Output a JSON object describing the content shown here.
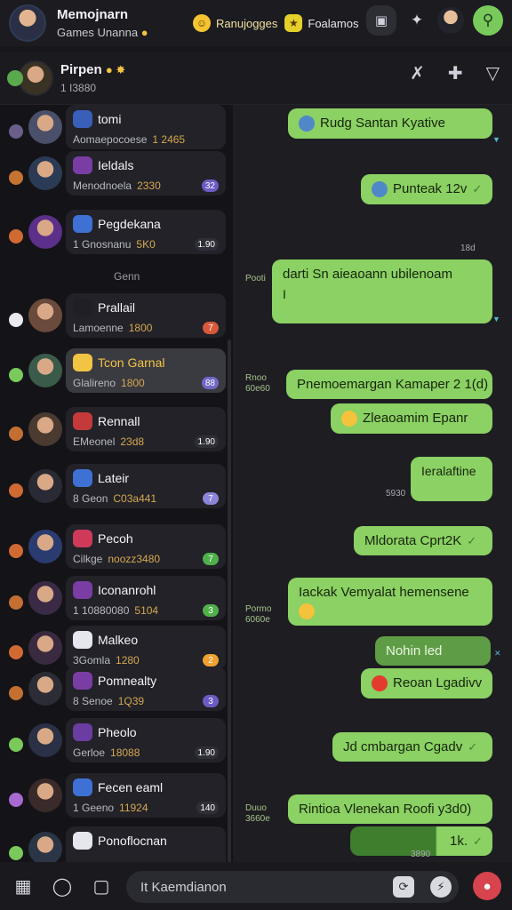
{
  "top": {
    "title": "Memojnarn",
    "subtitle": "Games Unanna",
    "chip1": "Ranujogges",
    "chip2": "Foalamos"
  },
  "chat_header": {
    "name": "Pirpen",
    "sub": "1 I3880"
  },
  "section_label": "Genn",
  "chats": [
    {
      "name": "tomi",
      "preview": "Aomaepocoese",
      "meta": "1 2465",
      "badge": "",
      "status": "#6a5f8a",
      "tile": "#3a5fb8",
      "avatar": "#4a4f6a",
      "badge_color": "#444"
    },
    {
      "name": "Ieldals",
      "preview": "Menodnoela",
      "meta": "2330",
      "badge": "32",
      "status": "#c47431",
      "tile": "#7a3da3",
      "avatar": "#2b3b55",
      "badge_color": "#6b5bc4"
    },
    {
      "name": "Pegdekana",
      "preview": "1 Gnosnanu",
      "meta": "5K0",
      "badge": "1.90",
      "status": "#d06a32",
      "tile": "#3f71d4",
      "avatar": "#5b2f8a",
      "badge_color": "#2f2f38"
    },
    {
      "name": "Prallail",
      "preview": "Lamoenne",
      "meta": "1800",
      "badge": "7",
      "status": "#e9e9ef",
      "tile": "#1f1f25",
      "avatar": "#6a4a3a",
      "badge_color": "#d8583a"
    },
    {
      "name": "Tcon Garnal",
      "preview": "Glalireno",
      "meta": "1800",
      "badge": "88",
      "status": "#79c95b",
      "tile": "#f2c443",
      "avatar": "#3a5a4a",
      "badge_color": "#7067c8",
      "active": true
    },
    {
      "name": "Rennall",
      "preview": "EMeonel",
      "meta": "23d8",
      "badge": "1.90",
      "status": "#c46f32",
      "tile": "#c43a3a",
      "avatar": "#4a3a30",
      "badge_color": "#2f2f38"
    },
    {
      "name": "Lateir",
      "preview": "8 Geon",
      "meta": "C03a441",
      "badge": "7",
      "status": "#d06a32",
      "tile": "#3f71d4",
      "avatar": "#2a2a35",
      "badge_color": "#8a85d8"
    },
    {
      "name": "Pecoh",
      "preview": "Cilkge",
      "meta": "noozz3480",
      "badge": "7",
      "status": "#d06a32",
      "tile": "#d03a5a",
      "avatar": "#2a3b70",
      "badge_color": "#4fb04a"
    },
    {
      "name": "Iconanrohl",
      "preview": "1 10880080",
      "meta": "5104",
      "badge": "3",
      "status": "#c46f32",
      "tile": "#7a3da3",
      "avatar": "#3b2a45",
      "badge_color": "#4fb04a"
    },
    {
      "name": "Malkeo",
      "preview": "3Gomla",
      "meta": "1280",
      "badge": "2",
      "status": "#d06a32",
      "tile": "#e6e6ee",
      "avatar": "#3a2a40",
      "badge_color": "#f0a030"
    },
    {
      "name": "Pomnealty",
      "preview": "8 Senoe",
      "meta": "1Q39",
      "badge": "3",
      "status": "#c46f32",
      "tile": "#7a3da3",
      "avatar": "#2c2c36",
      "badge_color": "#6b5bc4"
    },
    {
      "name": "Pheolo",
      "preview": "Gerloe",
      "meta": "18088",
      "badge": "1.90",
      "status": "#79c95b",
      "tile": "#6a3da3",
      "avatar": "#2a3045",
      "badge_color": "#2f2f38"
    },
    {
      "name": "Fecen eaml",
      "preview": "1 Geeno",
      "meta": "11924",
      "badge": "140",
      "status": "#a86ad0",
      "tile": "#3f71d4",
      "avatar": "#3a2a2a",
      "badge_color": "#2f2f38"
    },
    {
      "name": "Ponoflocnan",
      "preview": "",
      "meta": "",
      "badge": "",
      "status": "#79c95b",
      "tile": "#e6e6ee",
      "avatar": "#2a3545",
      "badge_color": "#2f2f38"
    }
  ],
  "messages": [
    {
      "text": "Rudg Santan Kyative",
      "ts": ""
    },
    {
      "text": "Punteak 12v",
      "ts": ""
    },
    {
      "text": "darti Sn aieaoann ubilenoam",
      "sub": "I",
      "ts_left": "Pooti"
    },
    {
      "text": "Pnemoemargan Kamaper 2 1(d)",
      "ts_left": "Rnoo 60e60"
    },
    {
      "text": "Zleaoamim Epanr",
      "ts": ""
    },
    {
      "text": "Ieralaftine",
      "ts": ""
    },
    {
      "text": "Mldorata Cprt2K",
      "ts": ""
    },
    {
      "text": "Iackak Vemyalat hemensene",
      "ts_left": "Pormo 6060e"
    },
    {
      "text": "Nohin led",
      "ts": ""
    },
    {
      "text": "Reoan Lgadivv",
      "ts": ""
    },
    {
      "text": "Jd cmbargan Cgadv",
      "ts": ""
    },
    {
      "text": "Rintioa Vlenekan Roofi y3d0)",
      "ts_left": "Duuo 3660e"
    },
    {
      "text": "1k.",
      "ts": ""
    }
  ],
  "ts_small": [
    "18d",
    "5930",
    "3890"
  ],
  "input": {
    "placeholder": "It Kaemdianon"
  },
  "colors": {
    "accent": "#8bd163",
    "bg": "#17171b"
  }
}
